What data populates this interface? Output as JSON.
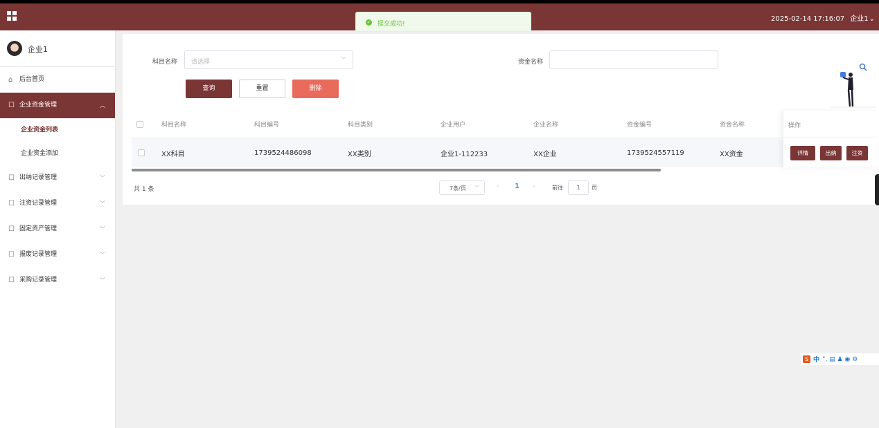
{
  "header": {
    "datetime": "2025-02-14 17:16:07",
    "user": "企业1",
    "user_chevron": "⌄"
  },
  "toast": {
    "message": "提交成功!"
  },
  "sidebar": {
    "username": "企业1",
    "items": [
      {
        "label": "后台首页",
        "icon": "home-icon"
      },
      {
        "label": "企业资金管理",
        "icon": "document-icon",
        "expanded": true,
        "children": [
          "企业资金列表",
          "企业资金添加"
        ]
      },
      {
        "label": "出纳记录管理",
        "icon": "document-icon"
      },
      {
        "label": "注资记录管理",
        "icon": "document-icon"
      },
      {
        "label": "固定资产管理",
        "icon": "document-icon"
      },
      {
        "label": "报废记录管理",
        "icon": "document-icon"
      },
      {
        "label": "采购记录管理",
        "icon": "document-icon"
      }
    ]
  },
  "search": {
    "subject_label": "科目名称",
    "subject_placeholder": "请选择",
    "fund_label": "资金名称",
    "fund_value": ""
  },
  "buttons": {
    "query": "查询",
    "reset": "重置",
    "delete": "删除"
  },
  "table": {
    "columns": [
      "科目名称",
      "科目编号",
      "科目类别",
      "企业用户",
      "企业名称",
      "资金编号",
      "资金名称",
      "操作"
    ],
    "rows": [
      {
        "cells": [
          "XX科目",
          "1739524486098",
          "XX类别",
          "企业1-112233",
          "XX企业",
          "1739524557119",
          "XX资金"
        ],
        "actions": [
          "详情",
          "出纳",
          "注资"
        ]
      }
    ]
  },
  "pagination": {
    "total": "共 1 条",
    "page_size": "7条/页",
    "current_page": "1",
    "goto_label": "前往",
    "goto_value": "1",
    "goto_suffix": "页"
  },
  "ime": {
    "brand": "S",
    "lang": "中",
    "symbols": "°, ▤ ♟ ◉ ⚙"
  },
  "colors": {
    "primary": "#7a3535",
    "danger": "#e86b5c",
    "success": "#67c23a",
    "link": "#409eff"
  }
}
